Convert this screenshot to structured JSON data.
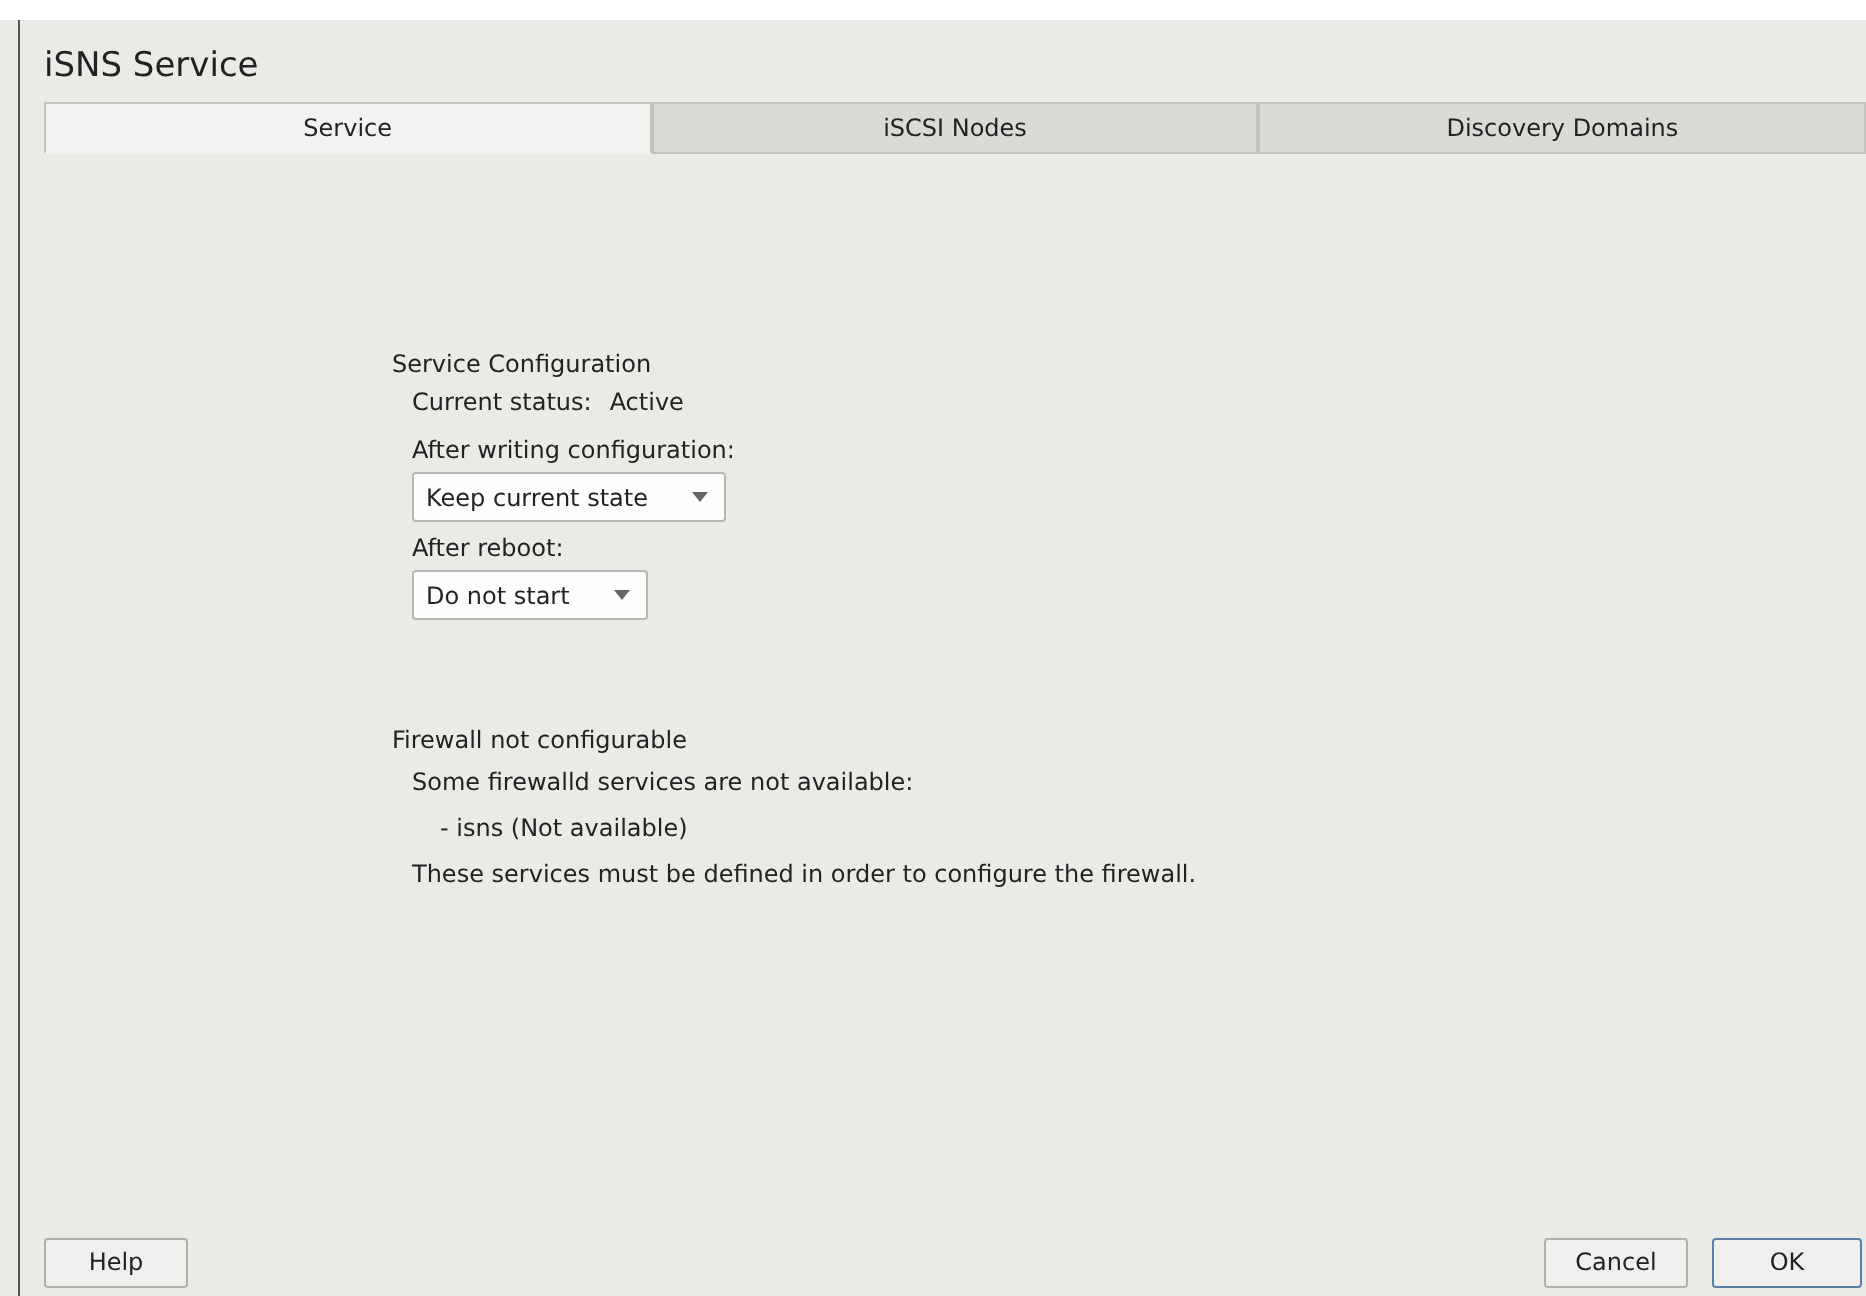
{
  "window": {
    "title": "iSNS Service"
  },
  "tabs": [
    {
      "label": "Service",
      "selected": true
    },
    {
      "label": "iSCSI Nodes",
      "selected": false
    },
    {
      "label": "Discovery Domains",
      "selected": false
    }
  ],
  "service_configuration": {
    "heading": "Service Configuration",
    "status_label": "Current status:",
    "status_value": "Active",
    "after_writing": {
      "label": "After writing configuration:",
      "value": "Keep current state"
    },
    "after_reboot": {
      "label": "After reboot:",
      "value": "Do not start"
    }
  },
  "firewall": {
    "heading": "Firewall not configurable",
    "intro": "Some firewalld services are not available:",
    "items": [
      "- isns (Not available)"
    ],
    "note": "These services must be defined in order to configure the firewall."
  },
  "buttons": {
    "help": "Help",
    "cancel": "Cancel",
    "ok": "OK"
  }
}
